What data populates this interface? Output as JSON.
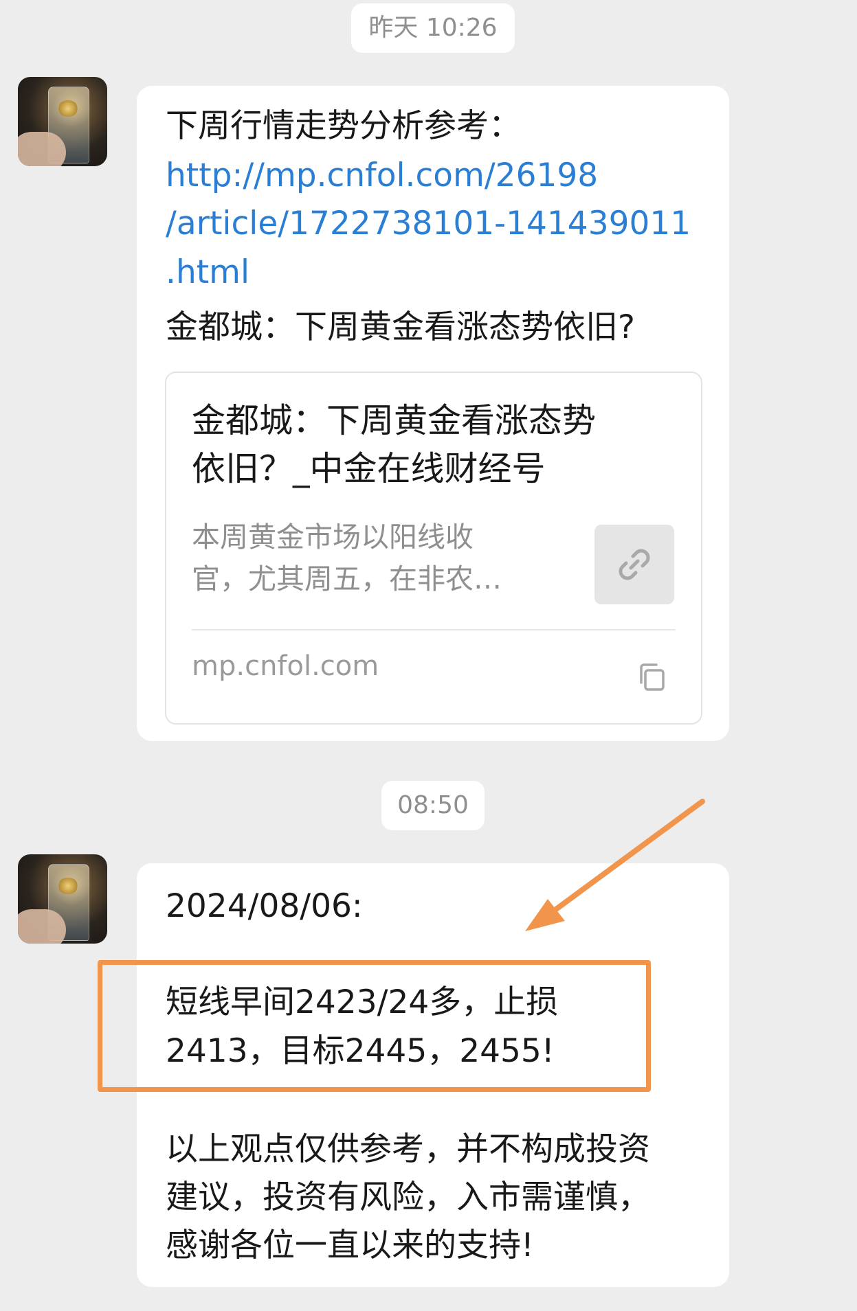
{
  "timestamps": {
    "first": "昨天 10:26",
    "second": "08:50"
  },
  "message1": {
    "intro": "下周行情走势分析参考：",
    "link_lines": [
      "http://mp.cnfol.com/26198",
      "/article/1722738101-141439011",
      ".html"
    ],
    "headline": "金都城：下周黄金看涨态势依旧?",
    "card": {
      "title_lines": [
        "金都城：下周黄金看涨态势",
        "依旧？_中金在线财经号"
      ],
      "desc_lines": [
        "本周黄金市场以阳线收",
        "官，尤其周五，在非农…"
      ],
      "domain": "mp.cnfol.com",
      "thumb_icon": "link-icon",
      "copy_icon": "copy-icon"
    }
  },
  "message2": {
    "date": "2024/08/06:",
    "signal_lines": [
      "短线早间2423/24多，止损",
      "2413，目标2445，2455!"
    ],
    "disclaimer_lines": [
      "以上观点仅供参考，并不构成投资",
      "建议，投资有风险，入市需谨慎，",
      "感谢各位一直以来的支持!"
    ]
  },
  "annotation": {
    "color": "#f0954b"
  }
}
